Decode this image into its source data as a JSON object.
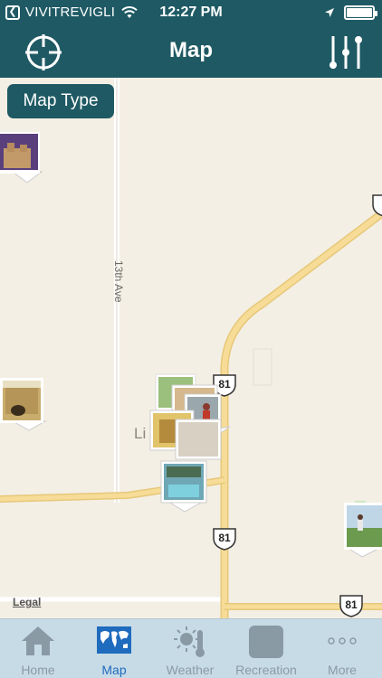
{
  "status_bar": {
    "carrier": "VIVITREVIGLI",
    "time": "12:27 PM",
    "battery_level": 1.0
  },
  "nav": {
    "title": "Map"
  },
  "map": {
    "map_type_label": "Map Type",
    "road_label": "13th Ave",
    "town_label_partial": "Li",
    "highway_labels": [
      "81",
      "81",
      "81"
    ],
    "legal_label": "Legal"
  },
  "tabs": [
    {
      "label": "Home",
      "icon": "home-icon"
    },
    {
      "label": "Map",
      "icon": "world-map-icon",
      "active": true
    },
    {
      "label": "Weather",
      "icon": "weather-icon"
    },
    {
      "label": "Recreation",
      "icon": "recreation-icon"
    },
    {
      "label": "More",
      "icon": "more-icon"
    }
  ],
  "colors": {
    "brand": "#1f5a64",
    "map_bg": "#f4efe4",
    "road_major": "#f6d98e",
    "tab_active": "#1f6bbd",
    "tab_inactive": "#8a9aa5"
  }
}
